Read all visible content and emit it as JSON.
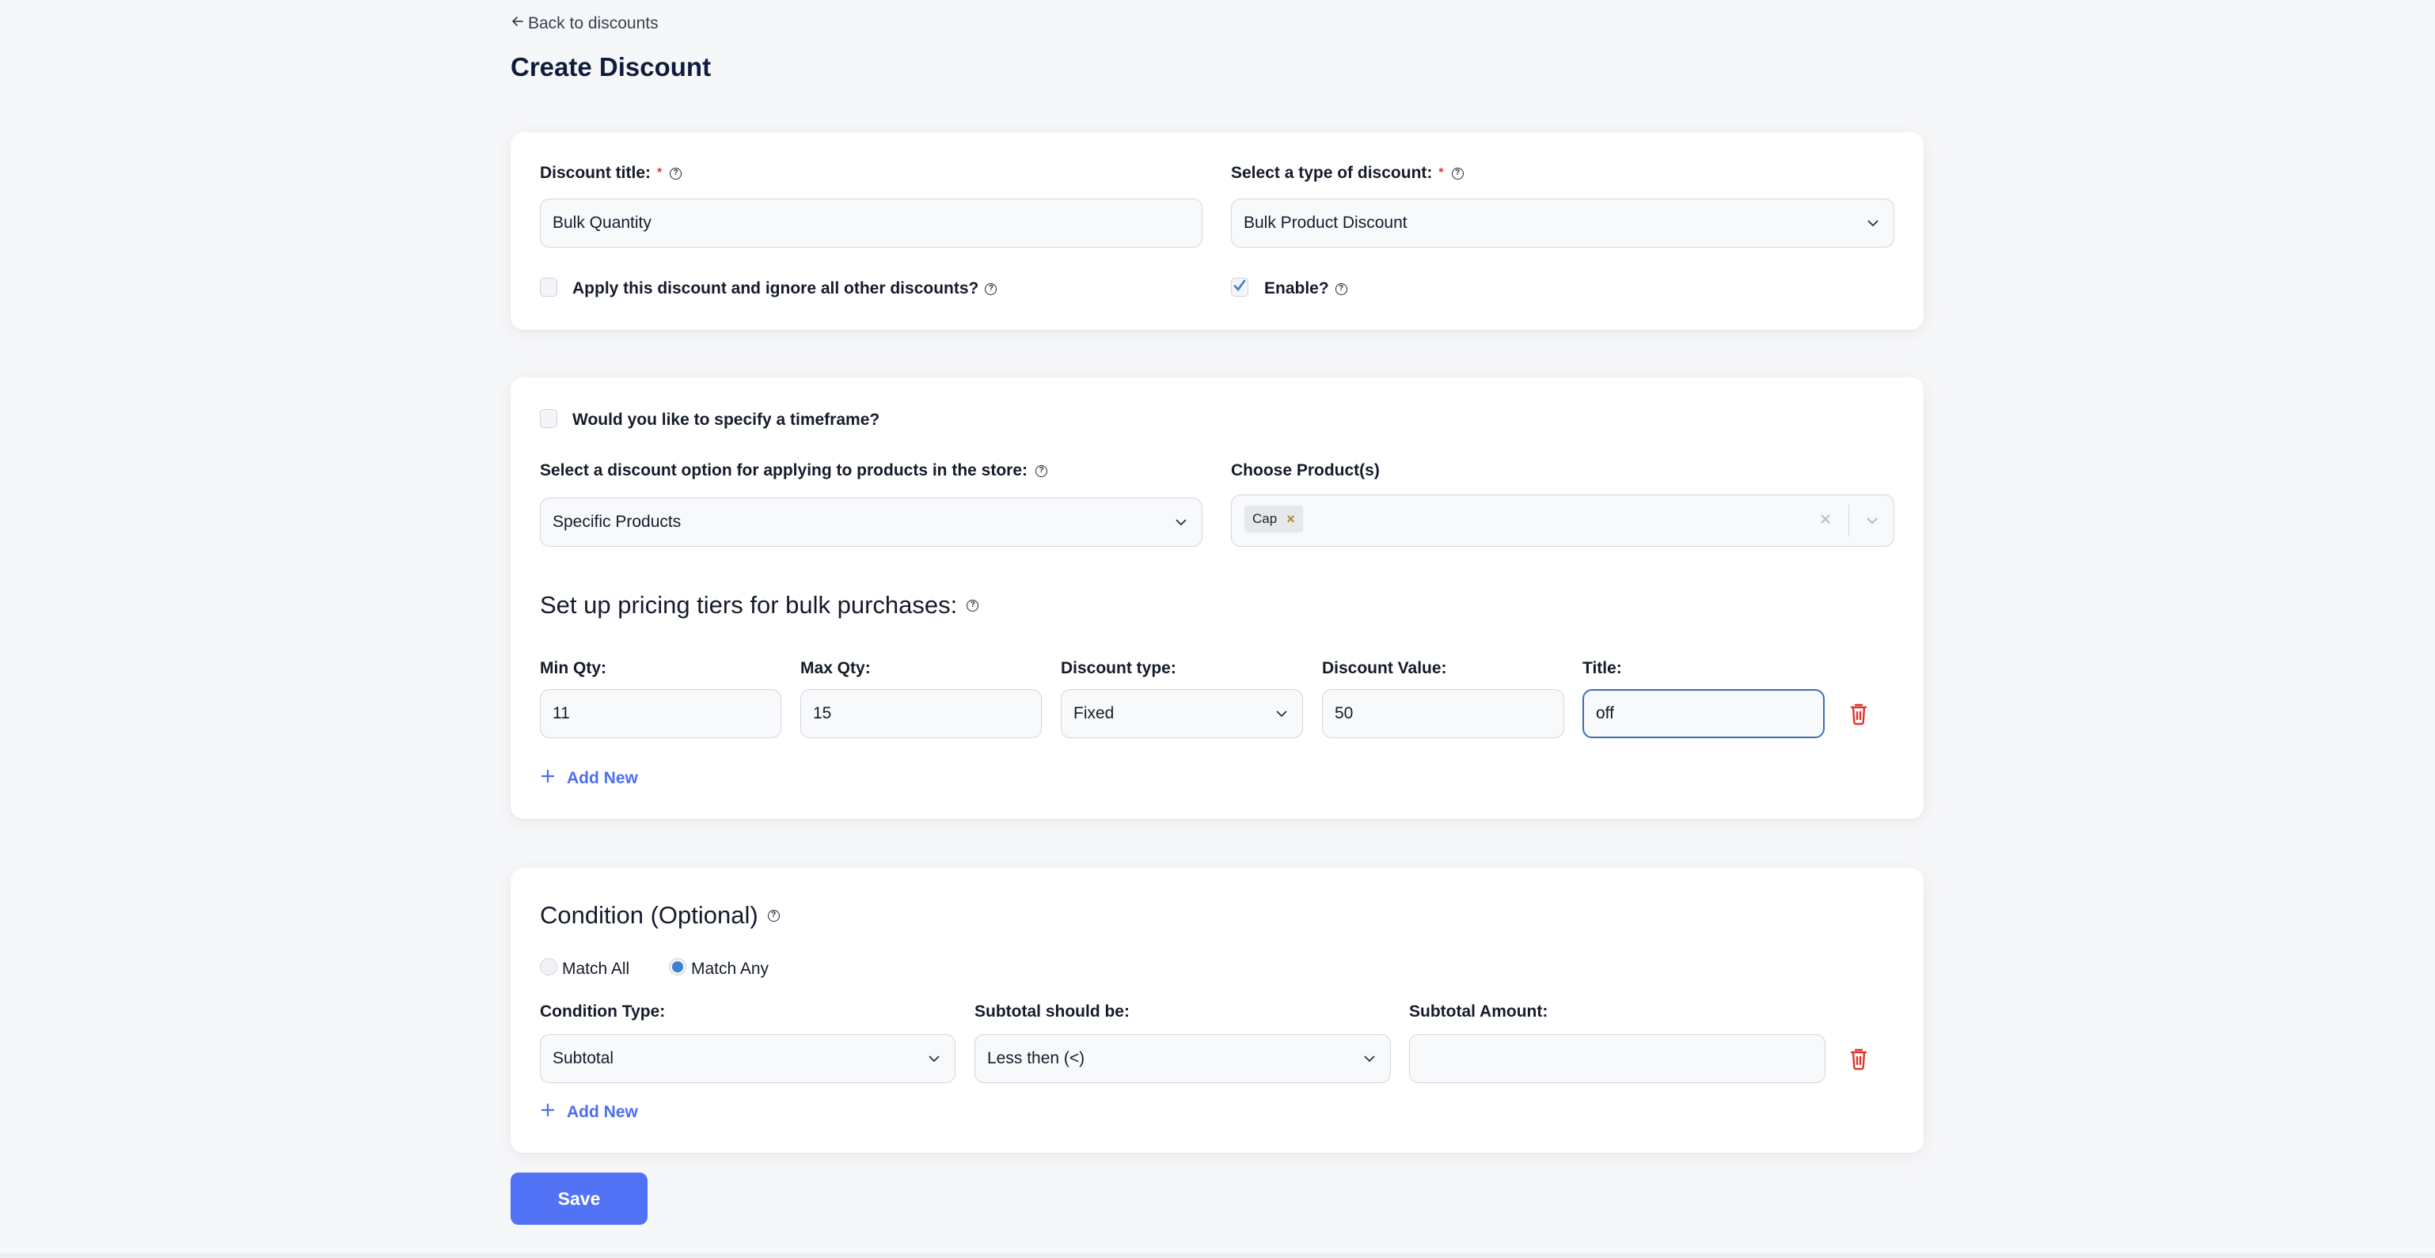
{
  "nav": {
    "back_label": "Back to discounts",
    "back_icon": "arrow-left-icon"
  },
  "page": {
    "title": "Create Discount"
  },
  "general": {
    "title_label": "Discount title:",
    "title_required": "*",
    "title_value": "Bulk Quantity",
    "type_label": "Select a type of discount:",
    "type_required": "*",
    "type_value": "Bulk Product Discount",
    "exclusive_label": "Apply this discount and ignore all other discounts?",
    "exclusive_checked": false,
    "enable_label": "Enable?",
    "enable_checked": true
  },
  "products": {
    "timeframe_label": "Would you like to specify a timeframe?",
    "timeframe_checked": false,
    "apply_option_label": "Select a discount option for applying to products in the store:",
    "apply_option_value": "Specific Products",
    "choose_label": "Choose Product(s)",
    "selected": [
      {
        "label": "Cap",
        "remove_icon": "x-icon"
      }
    ]
  },
  "tiers": {
    "heading": "Set up pricing tiers for bulk purchases:",
    "columns": {
      "min_qty": "Min Qty:",
      "max_qty": "Max Qty:",
      "discount_type": "Discount type:",
      "discount_value": "Discount Value:",
      "title": "Title:"
    },
    "rows": [
      {
        "min_qty": "11",
        "max_qty": "15",
        "discount_type": "Fixed",
        "discount_value": "50",
        "title": "off"
      }
    ],
    "add_new_label": "Add New"
  },
  "conditions": {
    "heading": "Condition (Optional)",
    "match_all_label": "Match All",
    "match_any_label": "Match Any",
    "selected_match": "Match Any",
    "columns": {
      "type": "Condition Type:",
      "operator": "Subtotal should be:",
      "amount": "Subtotal Amount:"
    },
    "rows": [
      {
        "type": "Subtotal",
        "operator": "Less then (<)",
        "amount": ""
      }
    ],
    "add_new_label": "Add New"
  },
  "actions": {
    "save_label": "Save"
  },
  "colors": {
    "primary": "#5172f4",
    "link": "#4f6ef0",
    "danger": "#e0352b",
    "focus_border": "#3b6fb6",
    "title_text": "#0f1d3d",
    "background": "#f6f7f9"
  }
}
